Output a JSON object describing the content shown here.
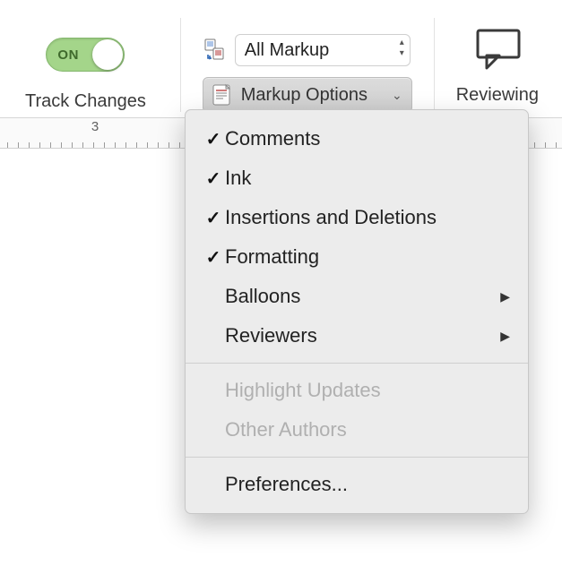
{
  "ribbon": {
    "track_changes": {
      "toggle_state": "ON",
      "caption": "Track Changes"
    },
    "markup": {
      "display_for_review_value": "All Markup",
      "options_button_label": "Markup Options"
    },
    "reviewing": {
      "caption": "Reviewing"
    }
  },
  "ruler": {
    "visible_number": "3"
  },
  "menu": {
    "items": [
      {
        "label": "Comments",
        "checked": true,
        "submenu": false,
        "enabled": true
      },
      {
        "label": "Ink",
        "checked": true,
        "submenu": false,
        "enabled": true
      },
      {
        "label": "Insertions and Deletions",
        "checked": true,
        "submenu": false,
        "enabled": true
      },
      {
        "label": "Formatting",
        "checked": true,
        "submenu": false,
        "enabled": true
      },
      {
        "label": "Balloons",
        "checked": false,
        "submenu": true,
        "enabled": true
      },
      {
        "label": "Reviewers",
        "checked": false,
        "submenu": true,
        "enabled": true
      }
    ],
    "items2": [
      {
        "label": "Highlight Updates",
        "checked": false,
        "submenu": false,
        "enabled": false
      },
      {
        "label": "Other Authors",
        "checked": false,
        "submenu": false,
        "enabled": false
      }
    ],
    "items3": [
      {
        "label": "Preferences...",
        "checked": false,
        "submenu": false,
        "enabled": true
      }
    ]
  }
}
